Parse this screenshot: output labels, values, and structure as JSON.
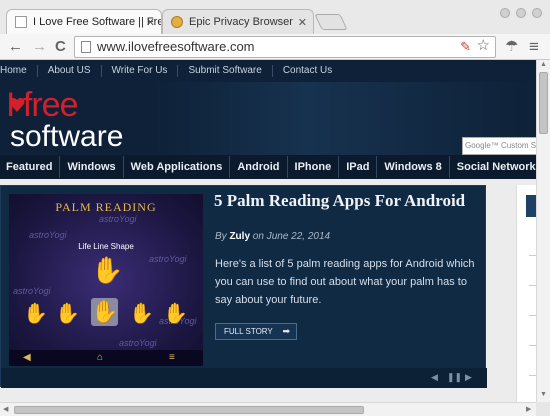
{
  "browser": {
    "tabs": [
      {
        "title": "I Love Free Software || Free",
        "active": true
      },
      {
        "title": "Epic Privacy Browser",
        "active": false
      }
    ],
    "close_glyph": "✕",
    "url": "www.ilovefreesoftware.com",
    "back_glyph": "←",
    "forward_glyph": "→",
    "reload_glyph": "C",
    "star_glyph": "☆",
    "menu_glyph": "≡",
    "umbrella_glyph": "☂",
    "plugin_glyph": "✎"
  },
  "site": {
    "topnav": [
      "Home",
      "About US",
      "Write For Us",
      "Submit Software",
      "Contact Us"
    ],
    "logo_line1": "I  free",
    "logo_line2": "software",
    "search_placeholder": "Google™ Custom Se",
    "categories": [
      "Featured",
      "Windows",
      "Web Applications",
      "Android",
      "IPhone",
      "IPad",
      "Windows 8",
      "Social Network"
    ]
  },
  "feature": {
    "thumb_title": "PALM READING",
    "thumb_subtitle": "Life Line Shape",
    "watermark": "astroYogi",
    "title": "5 Palm Reading Apps For Android",
    "by_label": "By",
    "author": "Zuly",
    "date_text": "on June 22, 2014",
    "description": "Here's a list of 5 palm reading apps for Android which you can use to find out about what your palm has to say about your future.",
    "button_label": "FULL STORY",
    "button_arrow": "➡",
    "ctrl_prev": "◀",
    "ctrl_pause": "❚❚",
    "ctrl_next": "▶"
  },
  "colors": {
    "header_bg": "#0e2138",
    "logo_red": "#d3202a",
    "feature_bg": "#112a44",
    "thumb_gold": "#e5b94a"
  }
}
